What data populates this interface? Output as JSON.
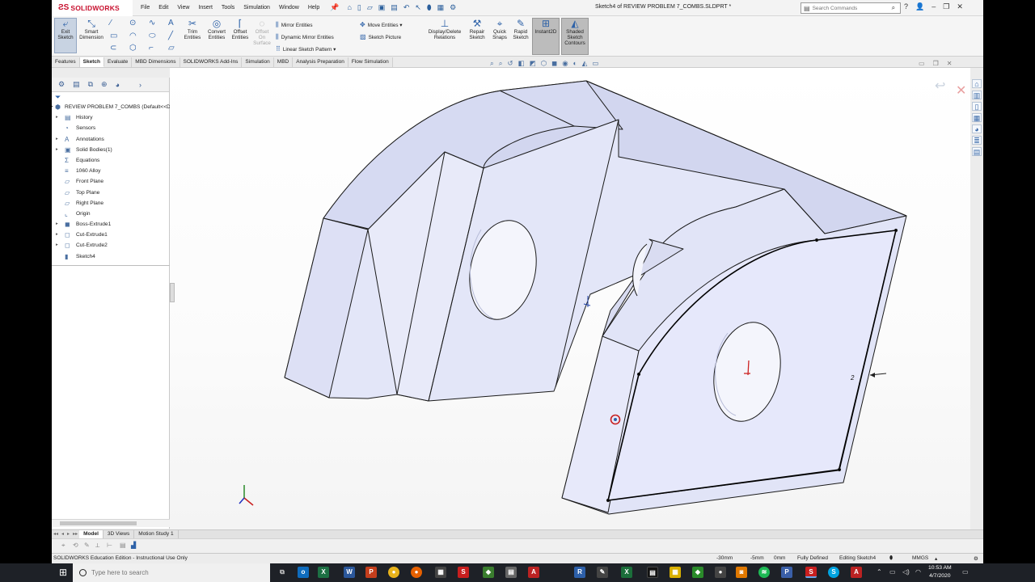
{
  "title_bar": {
    "logo_text": "SOLIDWORKS",
    "menus": [
      "File",
      "Edit",
      "View",
      "Insert",
      "Tools",
      "Simulation",
      "Window",
      "Help"
    ],
    "document_title": "Sketch4 of REVIEW PROBLEM 7_COMBS.SLDPRT *",
    "search_placeholder": "Search Commands"
  },
  "command_manager": {
    "exit_sketch": "Exit Sketch",
    "smart_dimension": "Smart Dimension",
    "trim_entities": "Trim Entities",
    "convert_entities": "Convert Entities",
    "offset_entities": "Offset Entities",
    "offset_on_surface": "Offset On Surface",
    "mirror_entities": "Mirror Entities",
    "dynamic_mirror_entities": "Dynamic Mirror Entities",
    "linear_sketch_pattern": "Linear Sketch Pattern",
    "move_entities": "Move Entities",
    "sketch_picture": "Sketch Picture",
    "display_delete_relations": "Display/Delete Relations",
    "repair_sketch": "Repair Sketch",
    "quick_snaps": "Quick Snaps",
    "rapid_sketch": "Rapid Sketch",
    "instant2d": "Instant2D",
    "shaded_sketch_contours": "Shaded Sketch Contours"
  },
  "tabs": [
    {
      "label": "Features",
      "active": false
    },
    {
      "label": "Sketch",
      "active": true
    },
    {
      "label": "Evaluate",
      "active": false
    },
    {
      "label": "MBD Dimensions",
      "active": false
    },
    {
      "label": "SOLIDWORKS Add-Ins",
      "active": false
    },
    {
      "label": "Simulation",
      "active": false
    },
    {
      "label": "MBD",
      "active": false
    },
    {
      "label": "Analysis Preparation",
      "active": false
    },
    {
      "label": "Flow Simulation",
      "active": false
    }
  ],
  "feature_tree": {
    "root": "REVIEW PROBLEM 7_COMBS  (Default<<Default>_Displ",
    "items": [
      {
        "label": "History",
        "icon": "history-icon",
        "expandable": true
      },
      {
        "label": "Sensors",
        "icon": "sensor-icon",
        "expandable": false
      },
      {
        "label": "Annotations",
        "icon": "annotation-icon",
        "expandable": true
      },
      {
        "label": "Solid Bodies(1)",
        "icon": "solid-body-icon",
        "expandable": true
      },
      {
        "label": "Equations",
        "icon": "equation-icon",
        "expandable": false
      },
      {
        "label": "1060 Alloy",
        "icon": "material-icon",
        "expandable": false
      },
      {
        "label": "Front Plane",
        "icon": "plane-icon",
        "expandable": false
      },
      {
        "label": "Top Plane",
        "icon": "plane-icon",
        "expandable": false
      },
      {
        "label": "Right Plane",
        "icon": "plane-icon",
        "expandable": false
      },
      {
        "label": "Origin",
        "icon": "origin-icon",
        "expandable": false
      },
      {
        "label": "Boss-Extrude1",
        "icon": "extrude-icon",
        "expandable": true
      },
      {
        "label": "Cut-Extrude1",
        "icon": "cut-icon",
        "expandable": true
      },
      {
        "label": "Cut-Extrude2",
        "icon": "cut-icon",
        "expandable": true
      },
      {
        "label": "Sketch4",
        "icon": "sketch-icon",
        "expandable": false
      }
    ]
  },
  "model_tabs": [
    {
      "label": "Model",
      "active": true
    },
    {
      "label": "3D Views",
      "active": false
    },
    {
      "label": "Motion Study 1",
      "active": false
    }
  ],
  "status_bar": {
    "edition": "SOLIDWORKS Education Edition - Instructional Use Only",
    "x": "-30mm",
    "y": "-5mm",
    "z": "0mm",
    "state": "Fully Defined",
    "editing": "Editing Sketch4",
    "units": "MMGS"
  },
  "sketch": {
    "dimension_label": "2"
  },
  "taskbar": {
    "search_placeholder": "Type here to search",
    "time": "10:53 AM",
    "date": "4/7/2020"
  },
  "colors": {
    "brand": "#c8102e",
    "part_face": "#dfe3f6",
    "accent": "#2e62a8"
  }
}
